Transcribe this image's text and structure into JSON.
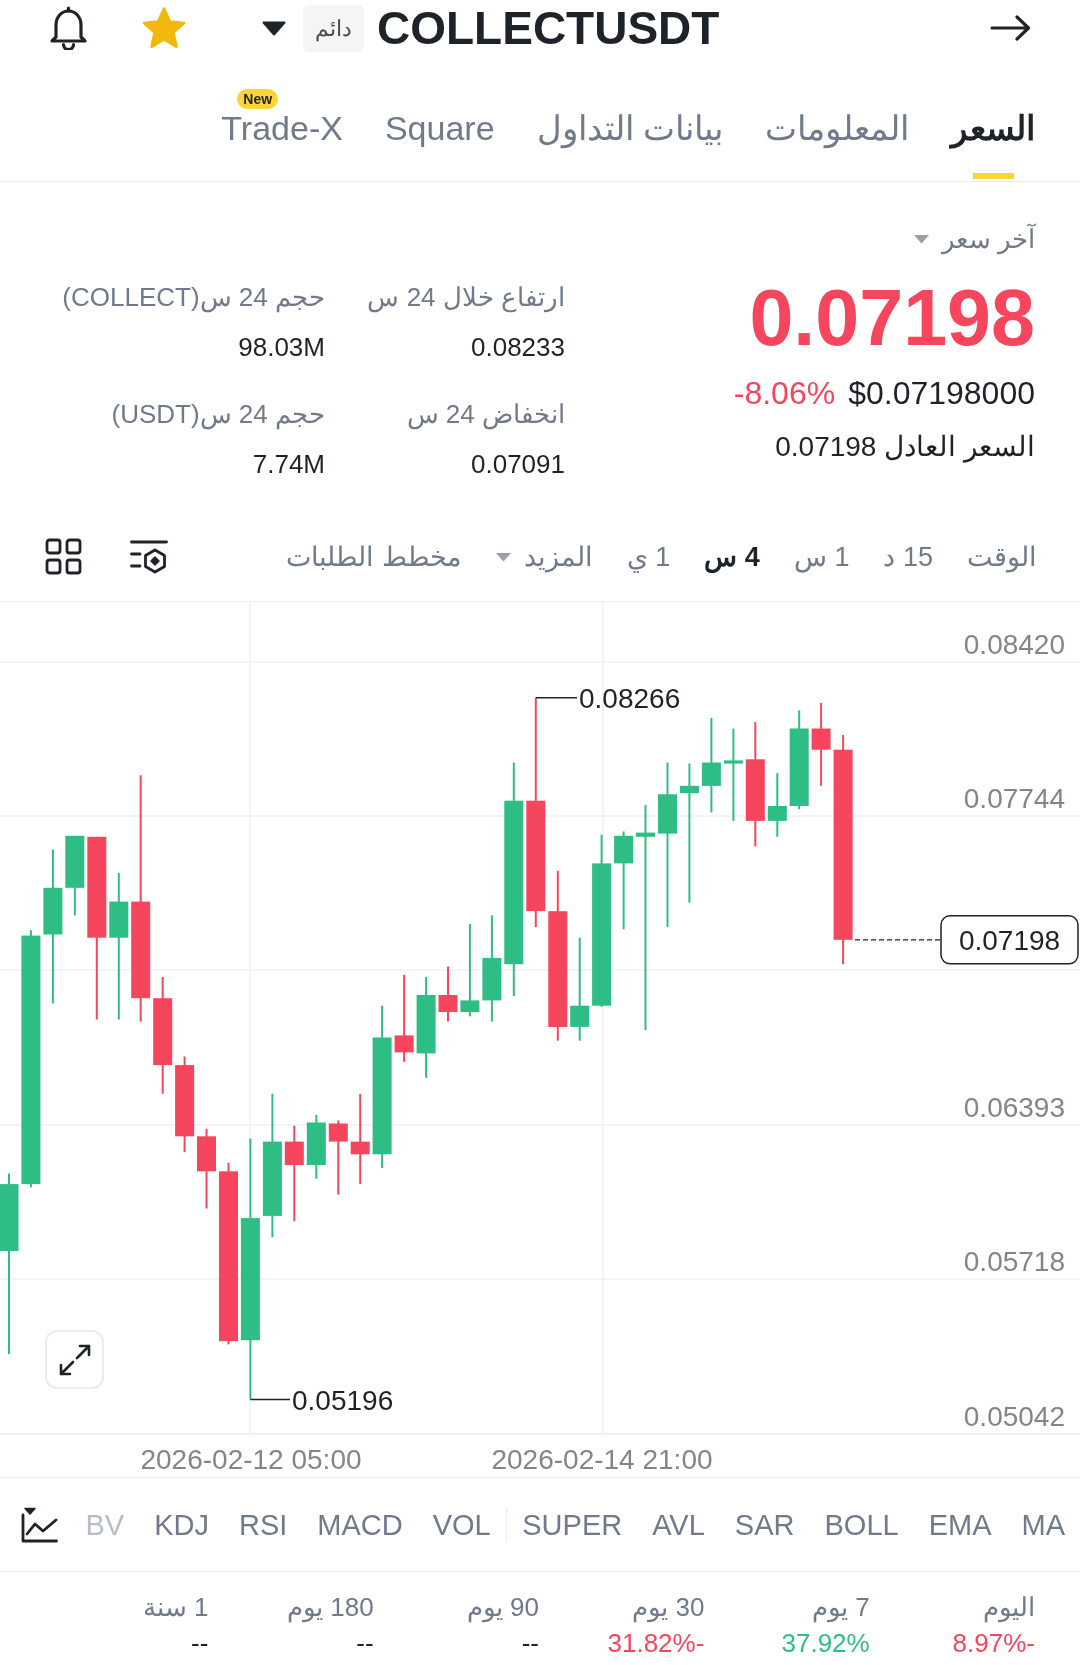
{
  "header": {
    "favorite": true,
    "contract_type": "دائم",
    "title": "COLLECTUSDT"
  },
  "tabs": [
    {
      "label": "السعر",
      "selected": true
    },
    {
      "label": "المعلومات",
      "selected": false
    },
    {
      "label": "بيانات التداول",
      "selected": false
    },
    {
      "label": "Square",
      "selected": false
    },
    {
      "label": "Trade-X",
      "selected": false,
      "badge": "New"
    }
  ],
  "price": {
    "type_label": "آخر سعر",
    "falling": true,
    "last": "0.07198",
    "change": "-8.06%",
    "usd_value": "$0.07198000",
    "fair_price": "السعر العادل 0.07198"
  },
  "stats": [
    {
      "label": "ارتفاع خلال 24 س",
      "value": "0.08233"
    },
    {
      "label": "حجم 24 س(COLLECT)",
      "value": "98.03M"
    },
    {
      "label": "انخفاض 24 س",
      "value": "0.07091"
    },
    {
      "label": "حجم 24 س(USDT)",
      "value": "7.74M"
    }
  ],
  "timeframes": [
    {
      "label": "الوقت",
      "kind": "option",
      "selected": false
    },
    {
      "label": "15 د",
      "kind": "option",
      "selected": false
    },
    {
      "label": "1 س",
      "kind": "option",
      "selected": false
    },
    {
      "label": "4 س",
      "kind": "option",
      "selected": true
    },
    {
      "label": "1 ي",
      "kind": "option",
      "selected": false
    },
    {
      "label": "المزيد",
      "kind": "dropdown",
      "selected": false
    },
    {
      "label": "مخطط الطلبات",
      "kind": "option",
      "selected": false
    }
  ],
  "chart": {
    "price_axis": [
      "0.08420",
      "0.07744",
      "0.06393",
      "0.05718",
      "0.05042"
    ],
    "time_axis": [
      "2026-02-14 21:00",
      "2026-02-12 05:00"
    ],
    "high_label": "0.08266",
    "low_label": "0.05196",
    "last_price_tag": "0.07198"
  },
  "indicator_groups": [
    {
      "items": [
        "MA",
        "EMA",
        "BOLL",
        "SAR",
        "AVL",
        "SUPER"
      ]
    },
    {
      "items": [
        "VOL",
        "MACD",
        "RSI",
        "KDJ",
        "BV"
      ]
    }
  ],
  "performance": [
    {
      "period": "اليوم",
      "value": "8.97%-",
      "color": "#f6465d"
    },
    {
      "period": "7 يوم",
      "value": "37.92%",
      "color": "#2ebd85"
    },
    {
      "period": "30 يوم",
      "value": "31.82%-",
      "color": "#f6465d"
    },
    {
      "period": "90 يوم",
      "value": "--",
      "color": "#1e2329"
    },
    {
      "period": "180 يوم",
      "value": "--",
      "color": "#1e2329"
    },
    {
      "period": "1 سنة",
      "value": "--",
      "color": "#1e2329"
    }
  ]
}
